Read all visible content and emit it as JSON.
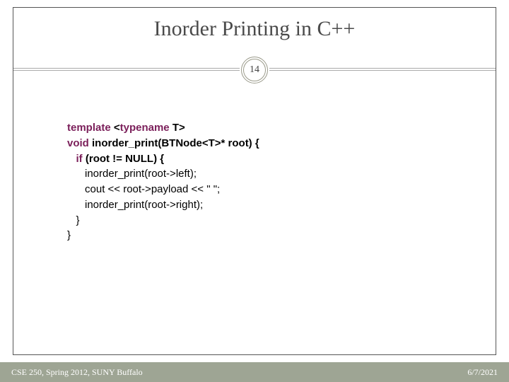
{
  "title": "Inorder Printing in C++",
  "slide_number": "14",
  "code": {
    "l1a": "template",
    "l1b": " <",
    "l1c": "typename",
    "l1d": " T>",
    "l2a": "void",
    "l2b": " inorder_print(BTNode<T>* root) {",
    "l3a": "   ",
    "l3b": "if",
    "l3c": " (root != NULL) {",
    "l4": "      inorder_print(root->left);",
    "l5": "      cout << root->payload << \" \";",
    "l6": "      inorder_print(root->right);",
    "l7": "   }",
    "l8": "}"
  },
  "footer": {
    "left": "CSE 250, Spring 2012, SUNY Buffalo",
    "right": "6/7/2021"
  }
}
